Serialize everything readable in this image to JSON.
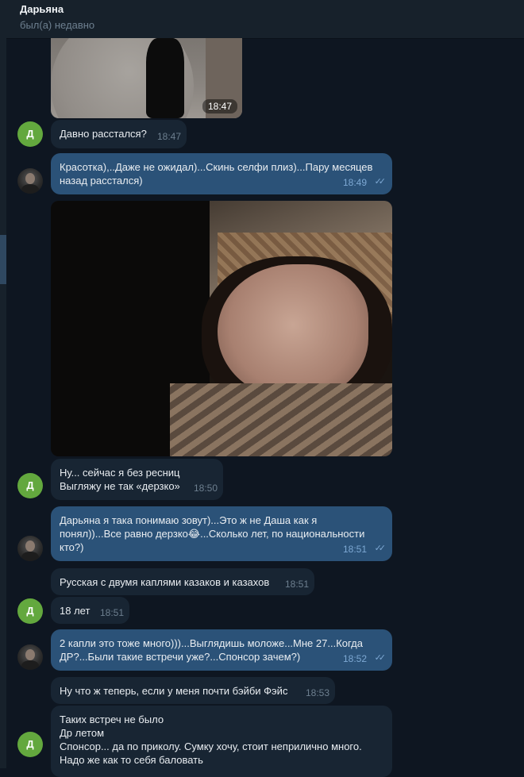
{
  "header": {
    "name": "Дарьяна",
    "status": "был(а) недавно"
  },
  "avatar_letter": "Д",
  "photo1_time": "18:47",
  "messages": [
    {
      "text": "Давно расстался?",
      "time": "18:47"
    },
    {
      "text": "Красотка),..Даже не ожидал)...Скинь селфи плиз)...Пару месяцев\nназад расстался)",
      "time": "18:49"
    },
    {
      "text": "Ну... сейчас я без ресниц\nВыгляжу не так «дерзко»",
      "time": "18:50"
    },
    {
      "text": "Дарьяна я така понимаю зовут)...Это ж не Даша как я\nпонял))...Все равно дерзко😂...Сколько лет, по национальности\nкто?)",
      "time": "18:51"
    },
    {
      "text": "Русская с двумя каплями казаков и казахов",
      "time": "18:51"
    },
    {
      "text": "18 лет",
      "time": "18:51"
    },
    {
      "text": "2 капли это тоже много)))...Выглядишь моложе...Мне 27...Когда\nДР?...Были такие встречи уже?...Спонсор зачем?)",
      "time": "18:52"
    },
    {
      "text": "Ну что ж теперь, если у меня почти бэйби Фэйс",
      "time": "18:53"
    },
    {
      "text": "Таких встреч не было\nДр летом\nСпонсор... да по приколу.  Сумку хочу, стоит неприлично много.\nНадо же как то себя баловать",
      "time": ""
    }
  ],
  "ticks": "✓✓",
  "colors": {
    "background": "#0e1621",
    "incoming": "#182533",
    "outgoing": "#2b5278",
    "avatar_green": "#63a83e"
  }
}
